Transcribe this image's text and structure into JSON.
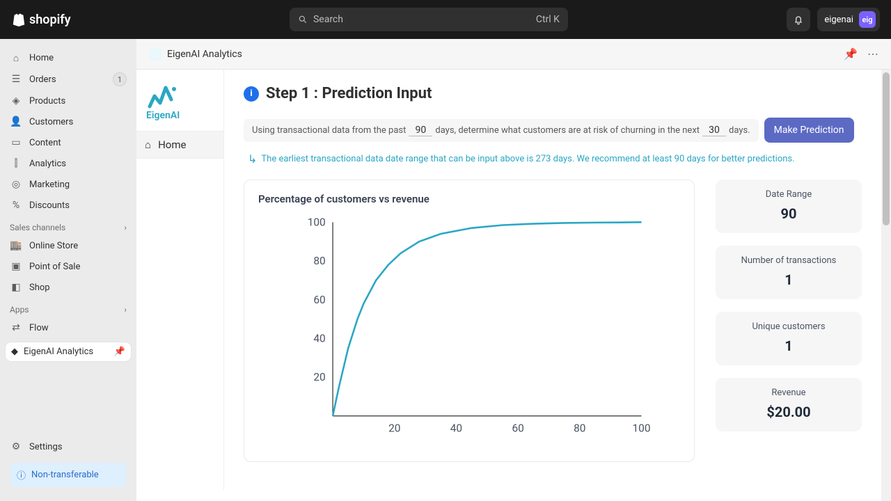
{
  "brand": "shopify",
  "search": {
    "placeholder": "Search",
    "shortcut": "Ctrl K"
  },
  "account": {
    "name": "eigenai",
    "initials": "eig"
  },
  "sidebar": {
    "items": [
      {
        "label": "Home",
        "icon": "home"
      },
      {
        "label": "Orders",
        "icon": "orders",
        "badge": "1"
      },
      {
        "label": "Products",
        "icon": "products"
      },
      {
        "label": "Customers",
        "icon": "customers"
      },
      {
        "label": "Content",
        "icon": "content"
      },
      {
        "label": "Analytics",
        "icon": "analytics"
      },
      {
        "label": "Marketing",
        "icon": "marketing"
      },
      {
        "label": "Discounts",
        "icon": "discounts"
      }
    ],
    "sales_channels_header": "Sales channels",
    "channels": [
      {
        "label": "Online Store"
      },
      {
        "label": "Point of Sale"
      },
      {
        "label": "Shop"
      }
    ],
    "apps_header": "Apps",
    "apps": [
      {
        "label": "Flow"
      }
    ],
    "pinned_app": "EigenAI Analytics",
    "settings": "Settings",
    "banner": "Non-transferable"
  },
  "app": {
    "title": "EigenAI Analytics",
    "brand": "EigenAI",
    "home_tab": "Home"
  },
  "step": {
    "title": "Step 1 : Prediction Input",
    "sentence": {
      "p1": "Using transactional data from the past",
      "v1": "90",
      "p2": "days, determine what customers are at risk of churning in the next",
      "v2": "30",
      "p3": "days."
    },
    "button": "Make Prediction",
    "help": "The earliest transactional data date range that can be input above is 273 days. We recommend at least 90 days for better predictions."
  },
  "chart": {
    "title": "Percentage of customers vs revenue"
  },
  "chart_data": {
    "type": "line",
    "title": "Percentage of customers vs revenue",
    "xlabel": "",
    "ylabel": "",
    "xlim": [
      0,
      100
    ],
    "ylim": [
      0,
      100
    ],
    "x_ticks": [
      20,
      40,
      60,
      80,
      100
    ],
    "y_ticks": [
      20,
      40,
      60,
      80,
      100
    ],
    "x": [
      0,
      2,
      5,
      8,
      10,
      14,
      18,
      22,
      28,
      35,
      45,
      55,
      65,
      75,
      85,
      95,
      100
    ],
    "values": [
      0,
      15,
      35,
      50,
      58,
      70,
      78,
      84,
      90,
      94,
      97,
      98.5,
      99.2,
      99.6,
      99.8,
      99.9,
      100
    ],
    "series_color": "#2aa7c4"
  },
  "stats": [
    {
      "label": "Date Range",
      "value": "90"
    },
    {
      "label": "Number of transactions",
      "value": "1"
    },
    {
      "label": "Unique customers",
      "value": "1"
    },
    {
      "label": "Revenue",
      "value": "$20.00"
    }
  ]
}
